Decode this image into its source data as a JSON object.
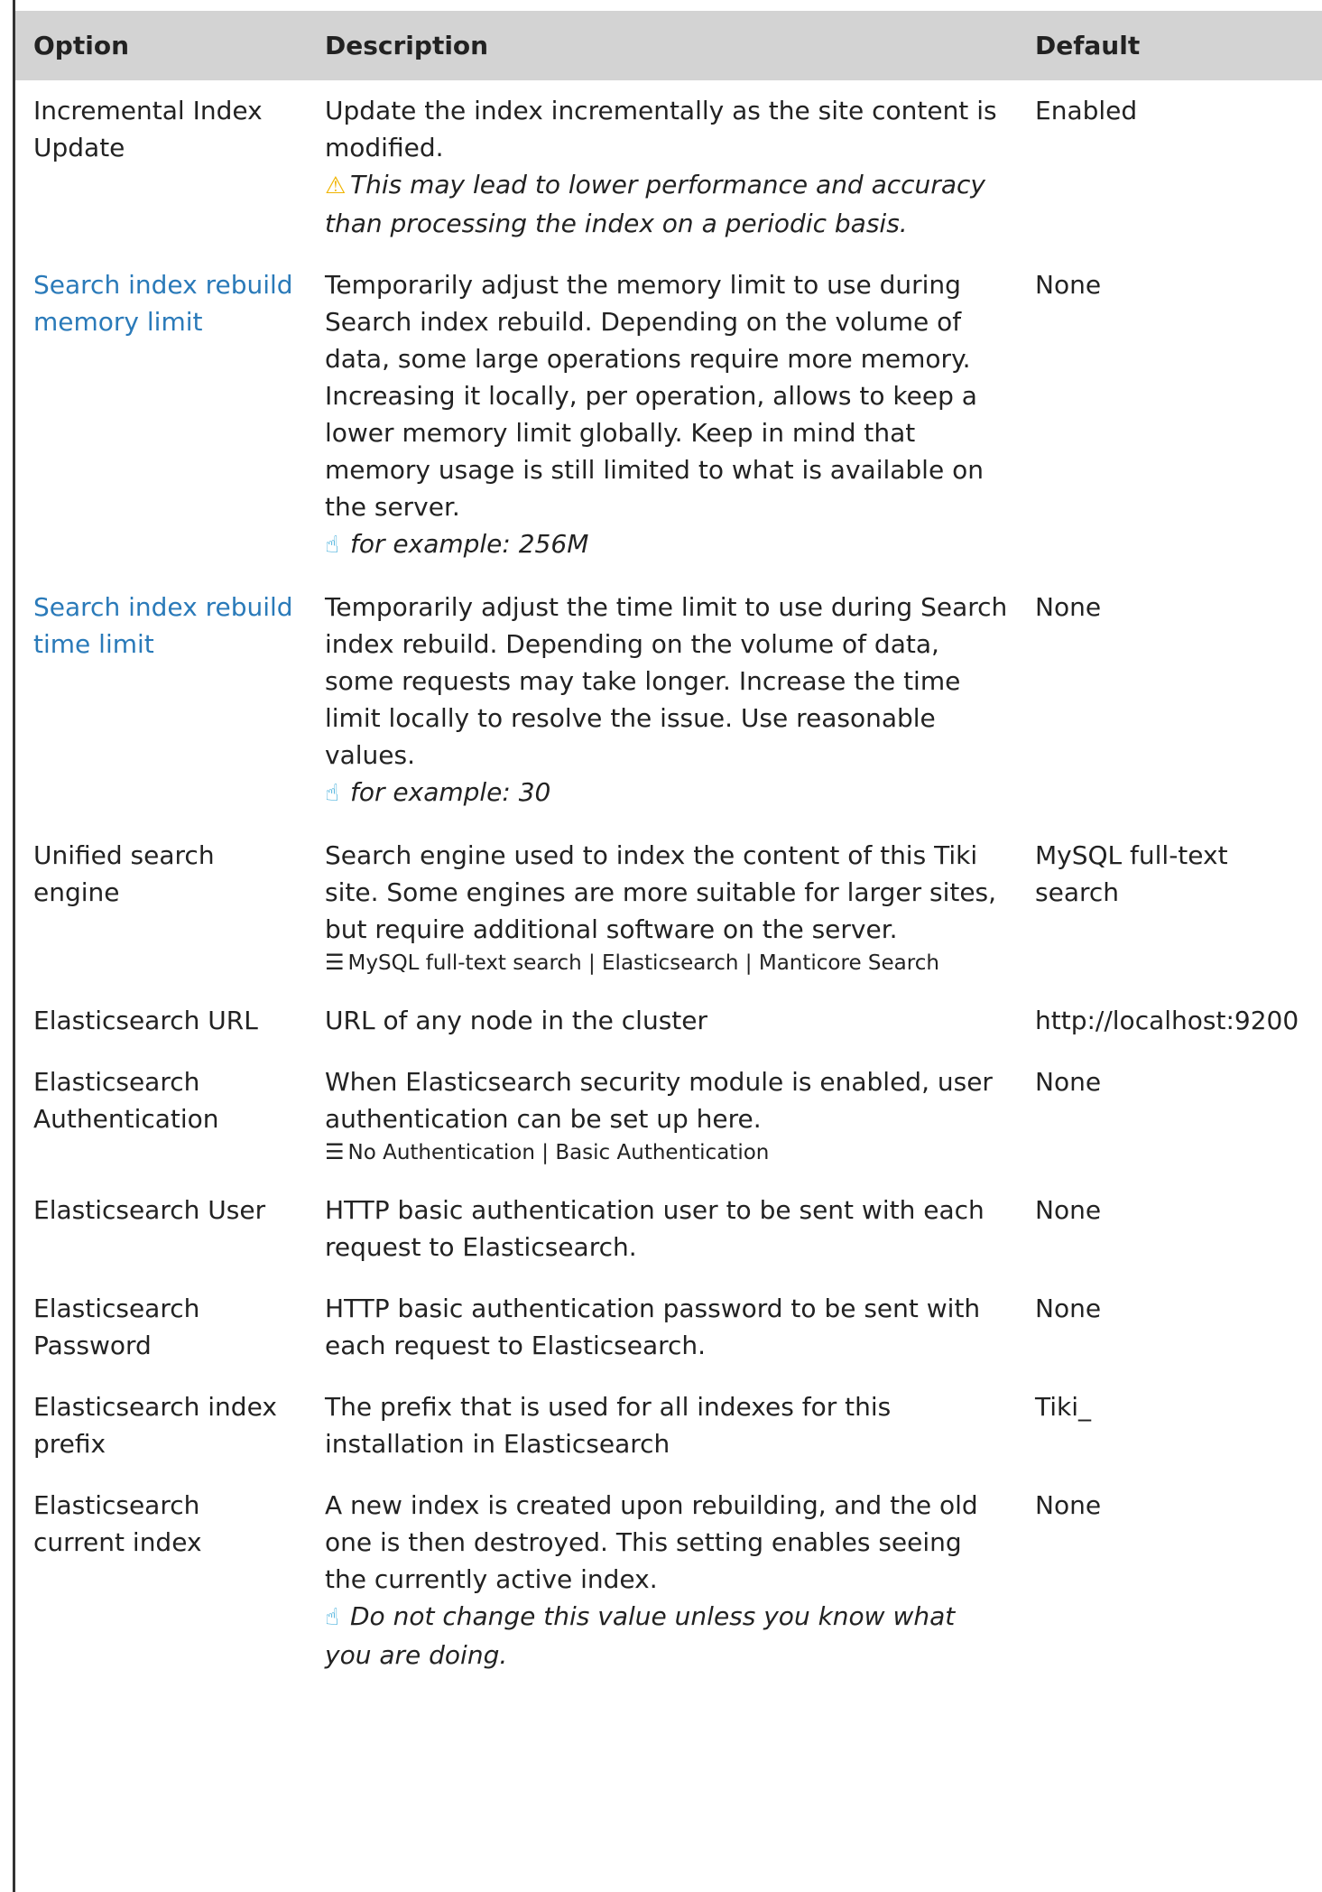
{
  "header": {
    "option": "Option",
    "description": "Description",
    "default": "Default"
  },
  "rows": [
    {
      "option": "Incremental Index Update",
      "option_is_link": false,
      "description": "Update the index incrementally as the site content is modified.",
      "note_type": "warning",
      "note": "This may lead to lower performance and accuracy than processing the index on a periodic basis.",
      "options_list": "",
      "default": "Enabled",
      "default_is_none": false
    },
    {
      "option": "Search index rebuild memory limit",
      "option_is_link": true,
      "description": "Temporarily adjust the memory limit to use during Search index rebuild. Depending on the volume of data, some large operations require more memory. Increasing it locally, per operation, allows to keep a lower memory limit globally. Keep in mind that memory usage is still limited to what is available on the server.",
      "note_type": "hint",
      "note": "for example: 256M",
      "options_list": "",
      "default": "None",
      "default_is_none": true
    },
    {
      "option": "Search index rebuild time limit",
      "option_is_link": true,
      "description": "Temporarily adjust the time limit to use during Search index rebuild. Depending on the volume of data, some requests may take longer. Increase the time limit locally to resolve the issue. Use reasonable values.",
      "note_type": "hint",
      "note": "for example: 30",
      "options_list": "",
      "default": "None",
      "default_is_none": true
    },
    {
      "option": "Unified search engine",
      "option_is_link": false,
      "description": "Search engine used to index the content of this Tiki site. Some engines are more suitable for larger sites, but require additional software on the server.",
      "note_type": "",
      "note": "",
      "options_list": "MySQL full-text search | Elasticsearch | Manticore Search",
      "default": "MySQL full-text search",
      "default_is_none": false
    },
    {
      "option": "Elasticsearch URL",
      "option_is_link": false,
      "description": "URL of any node in the cluster",
      "note_type": "",
      "note": "",
      "options_list": "",
      "default": "http://localhost:9200",
      "default_is_none": false
    },
    {
      "option": "Elasticsearch Authentication",
      "option_is_link": false,
      "description": "When Elasticsearch security module is enabled, user authentication can be set up here.",
      "note_type": "",
      "note": "",
      "options_list": "No Authentication | Basic Authentication",
      "default": "None",
      "default_is_none": true
    },
    {
      "option": "Elasticsearch User",
      "option_is_link": false,
      "description": "HTTP basic authentication user to be sent with each request to Elasticsearch.",
      "note_type": "",
      "note": "",
      "options_list": "",
      "default": "None",
      "default_is_none": true
    },
    {
      "option": "Elasticsearch Password",
      "option_is_link": false,
      "description": "HTTP basic authentication password to be sent with each request to Elasticsearch.",
      "note_type": "",
      "note": "",
      "options_list": "",
      "default": "None",
      "default_is_none": true
    },
    {
      "option": "Elasticsearch index prefix",
      "option_is_link": false,
      "description": "The prefix that is used for all indexes for this installation in Elasticsearch",
      "note_type": "",
      "note": "",
      "options_list": "",
      "default": "Tiki_",
      "default_is_none": false
    },
    {
      "option": "Elasticsearch current index",
      "option_is_link": false,
      "description": "A new index is created upon rebuilding, and the old one is then destroyed. This setting enables seeing the currently active index.",
      "note_type": "hint",
      "note": "Do not change this value unless you know what you are doing.",
      "options_list": "",
      "default": "None",
      "default_is_none": true
    }
  ],
  "icons": {
    "warning": "warning-icon",
    "hint": "pointing-hand-icon",
    "list": "list-icon"
  },
  "colors": {
    "header_bg": "#d3d3d3",
    "link": "#2a7ab9",
    "none_default": "#8a8a8a",
    "warning": "#f0b400",
    "hint": "#2aa3d6"
  }
}
